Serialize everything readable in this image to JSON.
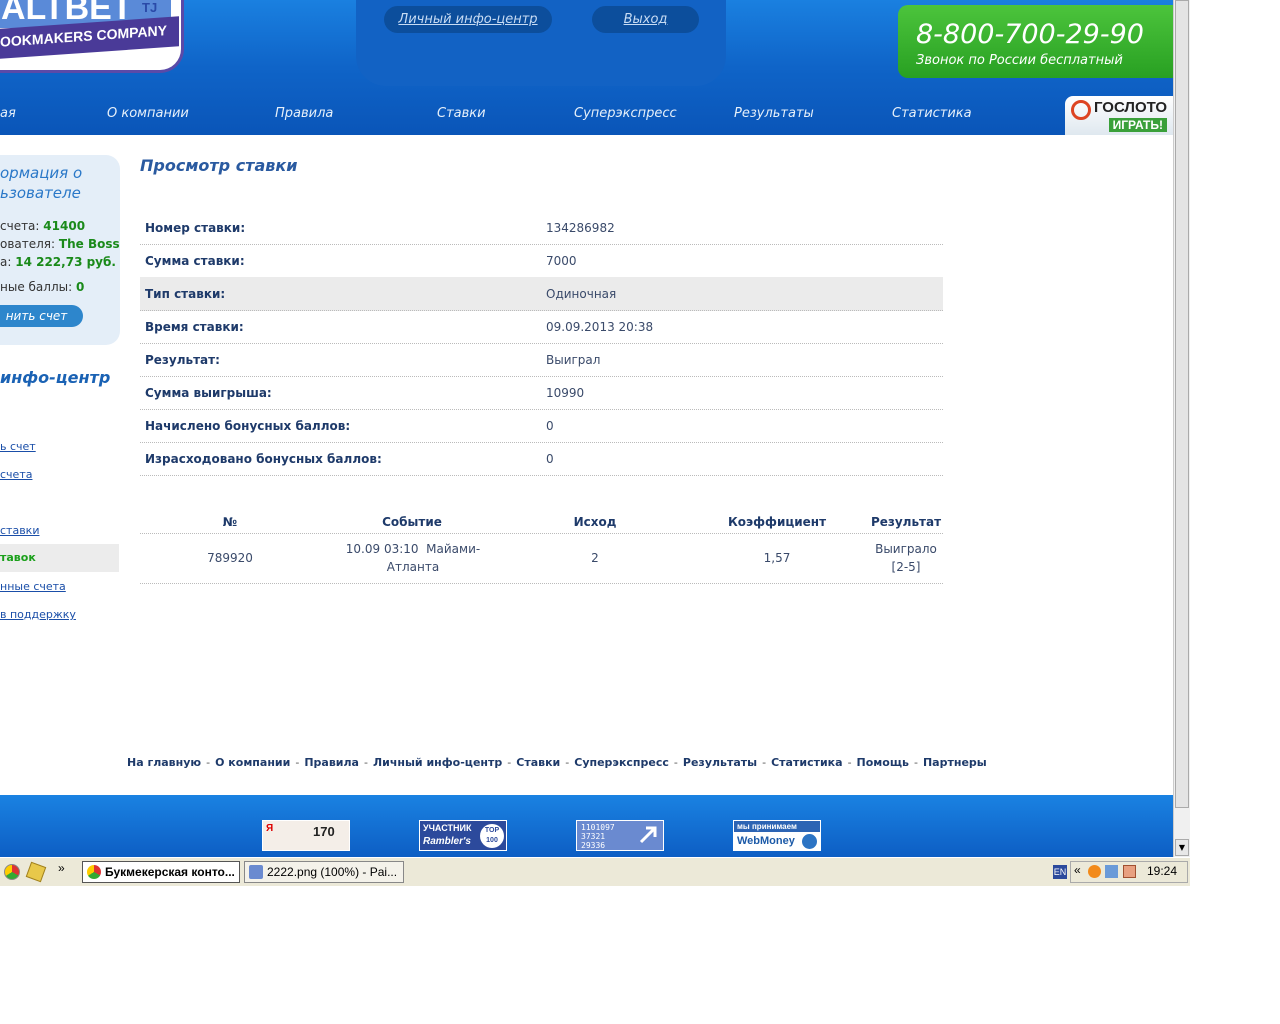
{
  "header": {
    "logo_top": "ALTBET",
    "logo_sup": "TJ",
    "logo_bottom": "BOOKMAKERS COMPANY",
    "personal_info_link": "Личный инфо-центр",
    "logout_link": "Выход",
    "phone": "8-800-700-29-90",
    "phone_caption": "Звонок по России бесплатный",
    "gosloto_title": "ГОСЛОТО",
    "gosloto_action": "ИГРАТЬ!"
  },
  "nav": [
    "ая",
    "О компании",
    "Правила",
    "Ставки",
    "Суперэкспресс",
    "Результаты",
    "Статистика"
  ],
  "sidebar": {
    "user_title_1": "ормация о",
    "user_title_2": "ьзователе",
    "account_label": "счета:",
    "account_value": "41400",
    "user_label": "ователя:",
    "user_value": "The Boss",
    "balance_label": "а:",
    "balance_value": "14 222,73 руб.",
    "bonus_label": "ные баллы:",
    "bonus_value": "0",
    "pay_button": "нить счет",
    "info_center_title": "инфо-центр",
    "links": [
      "ь счет",
      "счета",
      "ставки",
      "тавок",
      "нные счета",
      "в поддержку"
    ]
  },
  "main": {
    "title": "Просмотр ставки",
    "details": [
      {
        "label": "Номер ставки:",
        "value": "134286982"
      },
      {
        "label": "Сумма ставки:",
        "value": "7000"
      },
      {
        "label": "Тип ставки:",
        "value": "Одиночная"
      },
      {
        "label": "Время ставки:",
        "value": "09.09.2013 20:38"
      },
      {
        "label": "Результат:",
        "value": "Выиграл"
      },
      {
        "label": "Сумма выигрыша:",
        "value": "10990"
      },
      {
        "label": "Начислено бонусных баллов:",
        "value": "0"
      },
      {
        "label": "Израсходовано бонусных баллов:",
        "value": "0"
      }
    ],
    "table": {
      "headers": [
        "№",
        "Событие",
        "Исход",
        "Коэффициент",
        "Результат"
      ],
      "row": {
        "num": "789920",
        "event_1": "10.09 03:10  Майами-",
        "event_2": "Атланта",
        "outcome": "2",
        "coef": "1,57",
        "result_1": "Выиграло",
        "result_2": "[2-5]"
      }
    }
  },
  "footer": {
    "links": [
      "На главную",
      "О компании",
      "Правила",
      "Личный инфо-центр",
      "Ставки",
      "Суперэкспресс",
      "Результаты",
      "Статистика",
      "Помощь",
      "Партнеры"
    ],
    "separator": "-",
    "badge_yandex_letter": "Я",
    "badge_yandex_count": "170",
    "badge_rambler_1": "УЧАСТНИК",
    "badge_rambler_2": "Rambler's",
    "badge_rambler_top": "TOP 100",
    "badge_li_1": "1101097",
    "badge_li_2": "37321",
    "badge_li_3": "29336",
    "badge_wm_1": "мы принимаем",
    "badge_wm_2": "WebMoney"
  },
  "taskbar": {
    "window_1": "Букмекерская конто...",
    "window_2": "2222.png (100%) - Pai...",
    "lang": "EN",
    "chevron": "«",
    "quick_more": "»",
    "clock": "19:24"
  },
  "colors": {
    "header_blue": "#0f64c8",
    "accent_green": "#1a8a1a",
    "title_blue": "#2a5aa0"
  }
}
